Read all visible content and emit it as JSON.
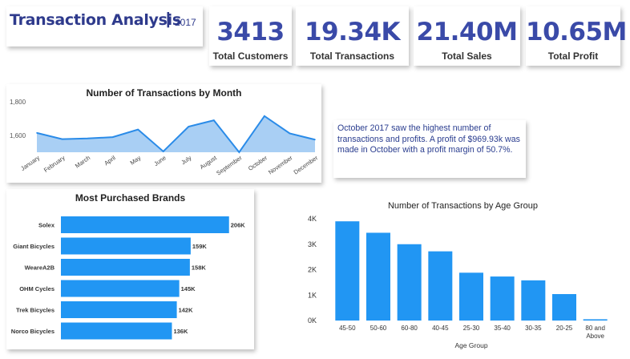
{
  "header": {
    "title": "Transaction Analysis",
    "separator": "|",
    "year": "2017"
  },
  "kpis": [
    {
      "value": "3413",
      "label": "Total Customers"
    },
    {
      "value": "19.34K",
      "label": "Total Transactions"
    },
    {
      "value": "21.40M",
      "label": "Total Sales"
    },
    {
      "value": "10.65M",
      "label": "Total Profit"
    }
  ],
  "insight": {
    "text": "October 2017 saw the highest number of transactions and profits. A profit of $969.93k was made in October with a profit margin of 50.7%."
  },
  "colors": {
    "accent": "#2196f3",
    "area_fill": "#a9cff4",
    "area_line": "#2a8be8",
    "title_blue": "#2e3a8c"
  },
  "chart_data": [
    {
      "type": "area",
      "title": "Number of Transactions by Month",
      "categories": [
        "January",
        "February",
        "March",
        "April",
        "May",
        "June",
        "July",
        "August",
        "September",
        "October",
        "November",
        "December"
      ],
      "values": [
        1615,
        1578,
        1582,
        1590,
        1635,
        1505,
        1652,
        1690,
        1500,
        1715,
        1612,
        1575
      ],
      "ylim": [
        1500,
        1800
      ],
      "yticks": [
        1600,
        1800
      ],
      "ytick_labels": [
        "1,600",
        "1,800"
      ],
      "grid": false
    },
    {
      "type": "bar",
      "orientation": "horizontal",
      "title": "Most Purchased Brands",
      "categories": [
        "Solex",
        "Giant Bicycles",
        "WeareA2B",
        "OHM Cycles",
        "Trek Bicycles",
        "Norco Bicycles"
      ],
      "values": [
        206,
        159,
        158,
        145,
        142,
        136
      ],
      "data_labels": [
        "206K",
        "159K",
        "158K",
        "145K",
        "142K",
        "136K"
      ],
      "xlim": [
        0,
        220
      ]
    },
    {
      "type": "bar",
      "title": "Number of Transactions by Age Group",
      "xlabel": "Age Group",
      "categories": [
        "45-50",
        "50-60",
        "60-80",
        "40-45",
        "25-30",
        "35-40",
        "30-35",
        "20-25",
        "80 and Above"
      ],
      "values": [
        3.9,
        3.45,
        3.0,
        2.72,
        1.88,
        1.73,
        1.58,
        1.04,
        0.05
      ],
      "ylim": [
        0,
        4
      ],
      "yticks": [
        0,
        1,
        2,
        3,
        4
      ],
      "ytick_labels": [
        "0K",
        "1K",
        "2K",
        "3K",
        "4K"
      ],
      "grid": false
    }
  ]
}
